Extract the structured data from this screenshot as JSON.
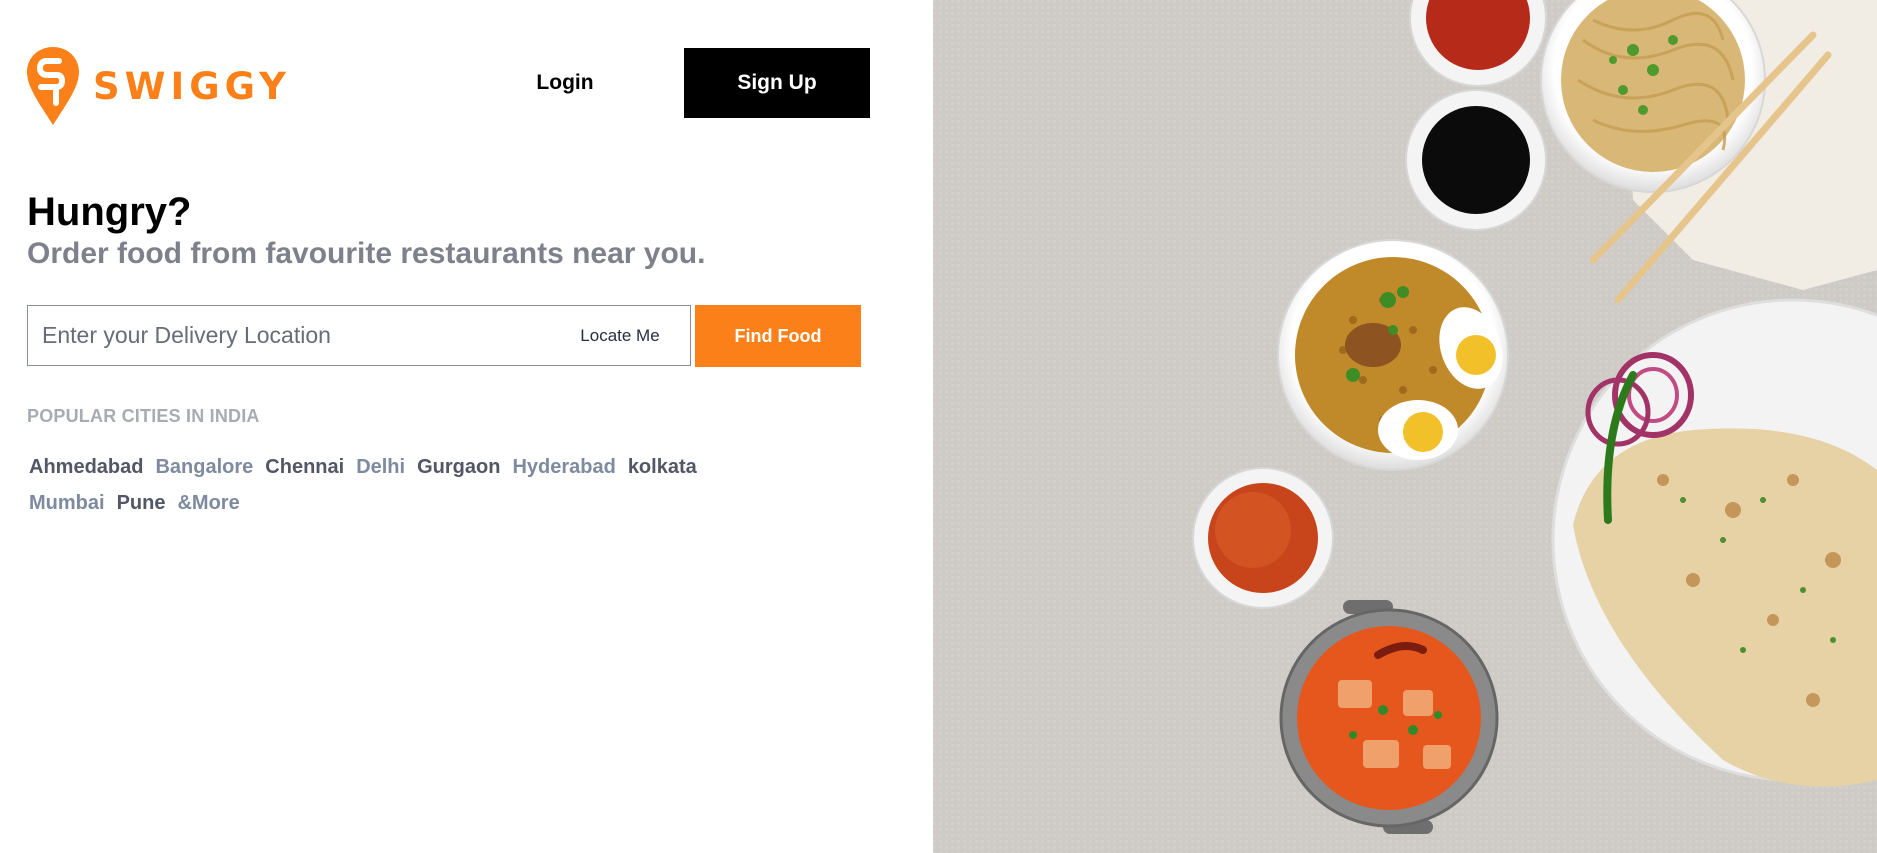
{
  "brand": {
    "name": "SWIGGY",
    "accent_color": "#fc8019"
  },
  "header": {
    "login_label": "Login",
    "signup_label": "Sign Up"
  },
  "hero": {
    "title": "Hungry?",
    "subtitle": "Order food from favourite restaurants near you."
  },
  "search": {
    "placeholder": "Enter your Delivery Location",
    "value": "",
    "locate_label": "Locate Me",
    "submit_label": "Find Food"
  },
  "popular": {
    "title": "POPULAR CITIES IN INDIA",
    "cities": [
      {
        "label": "Ahmedabad",
        "tone": "dark"
      },
      {
        "label": "Bangalore",
        "tone": "light"
      },
      {
        "label": "Chennai",
        "tone": "dark"
      },
      {
        "label": "Delhi",
        "tone": "light"
      },
      {
        "label": "Gurgaon",
        "tone": "dark"
      },
      {
        "label": "Hyderabad",
        "tone": "light"
      },
      {
        "label": "kolkata",
        "tone": "dark"
      },
      {
        "label": "Mumbai",
        "tone": "light"
      },
      {
        "label": "Pune",
        "tone": "dark"
      },
      {
        "label": "&More",
        "tone": "light"
      }
    ]
  }
}
